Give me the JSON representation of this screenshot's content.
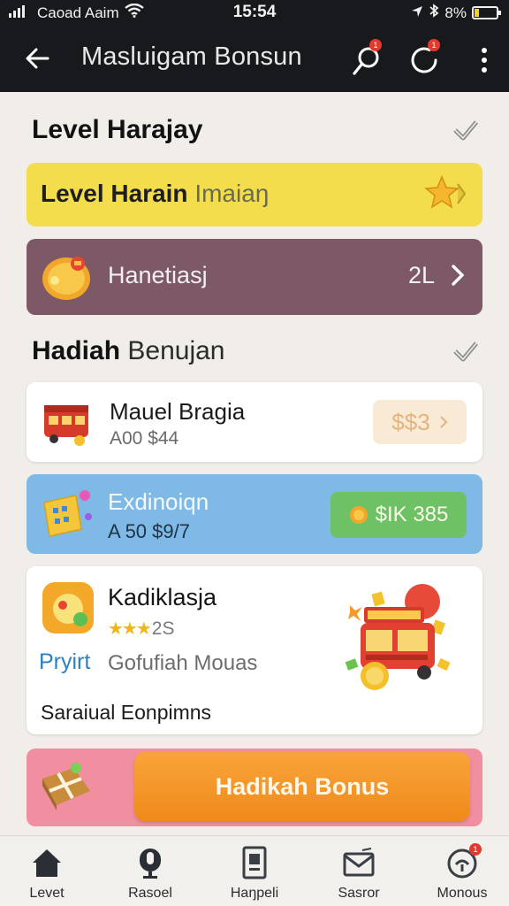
{
  "status_bar": {
    "carrier": "Caoad Aaim",
    "time": "15:54",
    "battery_text": "8%"
  },
  "header": {
    "title": "Masluigam Bonsun",
    "badge_a": "1",
    "badge_b": "1"
  },
  "section1": {
    "title": "Level Harajay"
  },
  "level_bar": {
    "label": "Level Harain",
    "sublabel": "Imaiaŋ"
  },
  "history_bar": {
    "label": "Hanetiasj",
    "count": "2L"
  },
  "section2": {
    "title_bold": "Hadiah",
    "title_light": "Benujan"
  },
  "rewards": [
    {
      "name": "Mauel Bragia",
      "price": "A00 $44",
      "pill": "$$3"
    },
    {
      "name": "Exdinoiqn",
      "price": "A 50 $9/7",
      "pill": "$IK 385"
    }
  ],
  "featured": {
    "name": "Kadiklasja",
    "rating_text": "2S",
    "brand": "Pryirt",
    "desc": "Gofufiah Mouas",
    "footer": "Saraiual Eonpimns"
  },
  "bonus_button": {
    "label": "Hadikah Bonus"
  },
  "nav": [
    {
      "label": "Levet"
    },
    {
      "label": "Rasoel"
    },
    {
      "label": "Haŋpeli"
    },
    {
      "label": "Sasror"
    },
    {
      "label": "Monous",
      "badge": "1"
    }
  ],
  "colors": {
    "header_bg": "#17191c",
    "yellow": "#f4dd4c",
    "maroon": "#7d5866",
    "blue": "#7fb9e6",
    "green": "#6ec165",
    "orange": "#f39a2a",
    "pink": "#f18ea0"
  }
}
